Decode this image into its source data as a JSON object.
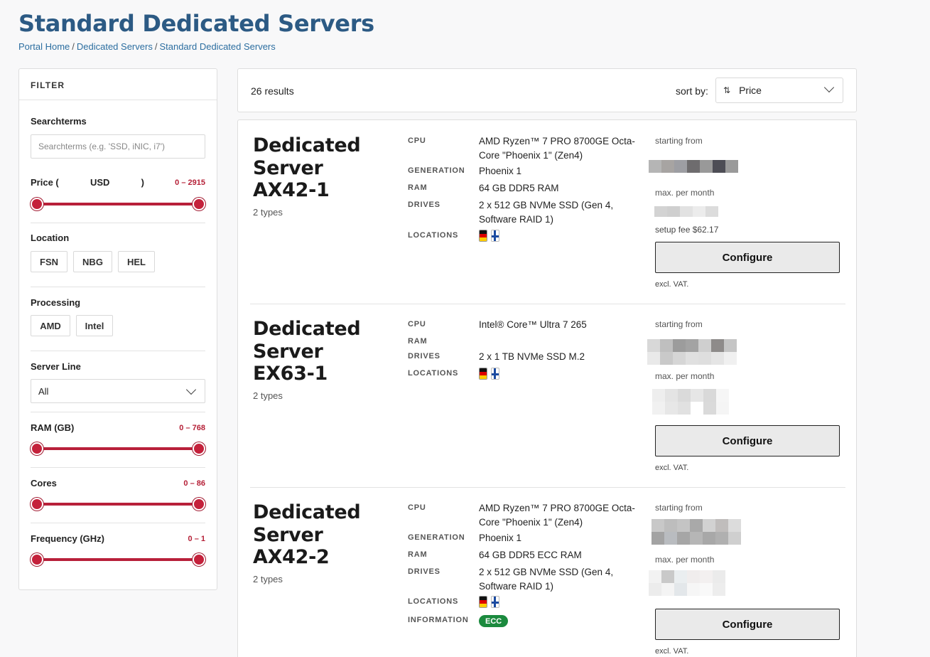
{
  "page": {
    "title": "Standard Dedicated Servers",
    "breadcrumb": [
      "Portal Home",
      "Dedicated Servers",
      "Standard Dedicated Servers"
    ]
  },
  "filter": {
    "heading": "FILTER",
    "searchterms_label": "Searchterms",
    "search_placeholder": "Searchterms (e.g. 'SSD, iNIC, i7')",
    "price_label": "Price (",
    "price_currency": "USD",
    "price_close": ")",
    "price_range": "0 – 2915",
    "location_label": "Location",
    "locations": [
      "FSN",
      "NBG",
      "HEL"
    ],
    "processing_label": "Processing",
    "processors": [
      "AMD",
      "Intel"
    ],
    "server_line_label": "Server Line",
    "server_line_value": "All",
    "ram_label": "RAM (GB)",
    "ram_range": "0 – 768",
    "cores_label": "Cores",
    "cores_range": "0 – 86",
    "freq_label": "Frequency (GHz)",
    "freq_range": "0 – 1"
  },
  "results": {
    "count": "26 results",
    "sort_label": "sort by:",
    "sort_value": "Price"
  },
  "spec_labels": {
    "cpu": "CPU",
    "generation": "GENERATION",
    "ram": "RAM",
    "drives": "DRIVES",
    "locations": "LOCATIONS",
    "information": "INFORMATION"
  },
  "products": [
    {
      "name": "Dedicated Server AX42-1",
      "types": "2 types",
      "cpu": "AMD Ryzen™ 7 PRO 8700GE Octa-Core \"Phoenix 1\" (Zen4)",
      "generation": "Phoenix 1",
      "ram": "64 GB DDR5 RAM",
      "drives": "2 x 512 GB NVMe SSD (Gen 4, Software RAID 1)",
      "starting_from": "starting from",
      "max_per_month": "max. per month",
      "setup_fee": "setup fee $62.17",
      "configure": "Configure",
      "vat": "excl. VAT."
    },
    {
      "name": "Dedicated Server EX63-1",
      "types": "2 types",
      "cpu": "Intel® Core™ Ultra 7 265",
      "ram": "",
      "drives": "2 x 1 TB NVMe SSD M.2",
      "starting_from": "starting from",
      "max_per_month": "max. per month",
      "configure": "Configure",
      "vat": "excl. VAT."
    },
    {
      "name": "Dedicated Server AX42-2",
      "types": "2 types",
      "cpu": "AMD Ryzen™ 7 PRO 8700GE Octa-Core \"Phoenix 1\" (Zen4)",
      "generation": "Phoenix 1",
      "ram": "64 GB DDR5 ECC RAM",
      "drives": "2 x 512 GB NVMe SSD (Gen 4, Software RAID 1)",
      "information_badge": "ECC",
      "starting_from": "starting from",
      "max_per_month": "max. per month",
      "configure": "Configure",
      "vat": "excl. VAT."
    }
  ],
  "colors": {
    "title": "#2c5a84",
    "link": "#2c6ea0",
    "accent": "#c4213b",
    "badge": "#1b8a3e"
  }
}
